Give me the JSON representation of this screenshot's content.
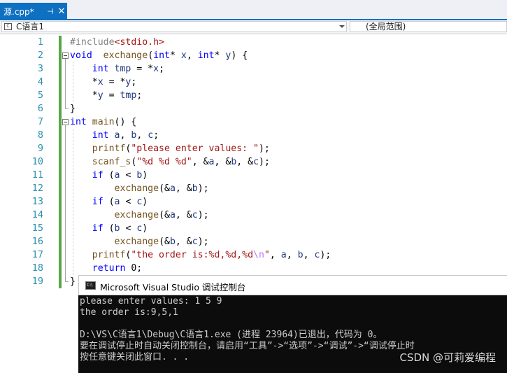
{
  "tab": {
    "title": "源.cpp*",
    "pin": "⊣",
    "close": "✕"
  },
  "nav": {
    "project": "C语言1",
    "scope": "(全局范围)"
  },
  "code_lines": [
    {
      "n": "1"
    },
    {
      "n": "2"
    },
    {
      "n": "3"
    },
    {
      "n": "4"
    },
    {
      "n": "5"
    },
    {
      "n": "6"
    },
    {
      "n": "7"
    },
    {
      "n": "8"
    },
    {
      "n": "9"
    },
    {
      "n": "10"
    },
    {
      "n": "11"
    },
    {
      "n": "12"
    },
    {
      "n": "13"
    },
    {
      "n": "14"
    },
    {
      "n": "15"
    },
    {
      "n": "16"
    },
    {
      "n": "17"
    },
    {
      "n": "18"
    },
    {
      "n": "19"
    }
  ],
  "code": {
    "l1": [
      [
        "pp",
        "#include"
      ],
      [
        "inc",
        "<stdio.h>"
      ]
    ],
    "l2": [
      [
        "kw",
        "void"
      ],
      [
        "",
        "  "
      ],
      [
        "fn",
        "exchange"
      ],
      [
        "",
        "("
      ],
      [
        "kw",
        "int"
      ],
      [
        "",
        "* "
      ],
      [
        "var",
        "x"
      ],
      [
        "",
        ", "
      ],
      [
        "kw",
        "int"
      ],
      [
        "",
        "* "
      ],
      [
        "var",
        "y"
      ],
      [
        "",
        ") {"
      ]
    ],
    "l3": [
      [
        "",
        "    "
      ],
      [
        "kw",
        "int"
      ],
      [
        "",
        ""
      ],
      [
        "var",
        " tmp"
      ],
      [
        "",
        ""
      ],
      [
        "",
        " = *"
      ],
      [
        "var",
        "x"
      ],
      [
        "",
        ";"
      ]
    ],
    "l4": [
      [
        "",
        "    *"
      ],
      [
        "var",
        "x"
      ],
      [
        "",
        ""
      ],
      [
        "",
        " = *"
      ],
      [
        "var",
        "y"
      ],
      [
        "",
        ";"
      ]
    ],
    "l5": [
      [
        "",
        "    *"
      ],
      [
        "var",
        "y"
      ],
      [
        "",
        ""
      ],
      [
        "",
        " = "
      ],
      [
        "var",
        "tmp"
      ],
      [
        "",
        ";"
      ]
    ],
    "l6": [
      [
        "",
        "}"
      ]
    ],
    "l7": [
      [
        "kw",
        "int"
      ],
      [
        "",
        " "
      ],
      [
        "fn",
        "main"
      ],
      [
        "",
        "() {"
      ]
    ],
    "l8": [
      [
        "",
        "    "
      ],
      [
        "kw",
        "int"
      ],
      [
        "",
        " "
      ],
      [
        "var",
        "a"
      ],
      [
        "",
        ", "
      ],
      [
        "var",
        "b"
      ],
      [
        "",
        ", "
      ],
      [
        "var",
        "c"
      ],
      [
        "",
        ";"
      ]
    ],
    "l9": [
      [
        "",
        "    "
      ],
      [
        "fn",
        "printf"
      ],
      [
        "",
        "("
      ],
      [
        "str",
        "\"please enter values: \""
      ],
      [
        "",
        ");"
      ]
    ],
    "l10": [
      [
        "",
        "    "
      ],
      [
        "fn",
        "scanf_s"
      ],
      [
        "",
        "("
      ],
      [
        "str",
        "\"%d %d %d\""
      ],
      [
        "",
        ", &"
      ],
      [
        "var",
        "a"
      ],
      [
        "",
        ", &"
      ],
      [
        "var",
        "b"
      ],
      [
        "",
        ", &"
      ],
      [
        "var",
        "c"
      ],
      [
        "",
        ");"
      ]
    ],
    "l11": [
      [
        "",
        "    "
      ],
      [
        "kw",
        "if"
      ],
      [
        "",
        " ("
      ],
      [
        "var",
        "a"
      ],
      [
        "",
        " < "
      ],
      [
        "var",
        "b"
      ],
      [
        "",
        ")"
      ]
    ],
    "l12": [
      [
        "",
        "        "
      ],
      [
        "fn",
        "exchange"
      ],
      [
        "",
        "(&"
      ],
      [
        "var",
        "a"
      ],
      [
        "",
        ", &"
      ],
      [
        "var",
        "b"
      ],
      [
        "",
        ");"
      ]
    ],
    "l13": [
      [
        "",
        "    "
      ],
      [
        "kw",
        "if"
      ],
      [
        "",
        " ("
      ],
      [
        "var",
        "a"
      ],
      [
        "",
        " < "
      ],
      [
        "var",
        "c"
      ],
      [
        "",
        ")"
      ]
    ],
    "l14": [
      [
        "",
        "        "
      ],
      [
        "fn",
        "exchange"
      ],
      [
        "",
        "(&"
      ],
      [
        "var",
        "a"
      ],
      [
        "",
        ", &"
      ],
      [
        "var",
        "c"
      ],
      [
        "",
        ");"
      ]
    ],
    "l15": [
      [
        "",
        "    "
      ],
      [
        "kw",
        "if"
      ],
      [
        "",
        " ("
      ],
      [
        "var",
        "b"
      ],
      [
        "",
        " < "
      ],
      [
        "var",
        "c"
      ],
      [
        "",
        ")"
      ]
    ],
    "l16": [
      [
        "",
        "        "
      ],
      [
        "fn",
        "exchange"
      ],
      [
        "",
        "(&"
      ],
      [
        "var",
        "b"
      ],
      [
        "",
        ", &"
      ],
      [
        "var",
        "c"
      ],
      [
        "",
        ");"
      ]
    ],
    "l17": [
      [
        "",
        "    "
      ],
      [
        "fn",
        "printf"
      ],
      [
        "",
        "("
      ],
      [
        "str",
        "\"the order is:%d,%d,%d"
      ],
      [
        "esc",
        "\\n"
      ],
      [
        "str",
        "\""
      ],
      [
        "",
        ", "
      ],
      [
        "var",
        "a"
      ],
      [
        "",
        ", "
      ],
      [
        "var",
        "b"
      ],
      [
        "",
        ", "
      ],
      [
        "var",
        "c"
      ],
      [
        "",
        ");"
      ]
    ],
    "l18": [
      [
        "",
        "    "
      ],
      [
        "kw",
        "return"
      ],
      [
        "",
        " 0;"
      ]
    ],
    "l19": [
      [
        "",
        "}"
      ]
    ]
  },
  "console": {
    "title": "Microsoft Visual Studio 调试控制台",
    "icon_text": "C:\\",
    "lines": [
      "please enter values: 1 5 9",
      "the order is:9,5,1",
      "",
      "D:\\VS\\C语言1\\Debug\\C语言1.exe (进程 23964)已退出，代码为 0。",
      "要在调试停止时自动关闭控制台，请启用“工具”->“选项”->“调试”->“调试停止时",
      "按任意键关闭此窗口. . ."
    ]
  },
  "watermark": "CSDN @可莉爱编程",
  "colors": {
    "accent": "#0e70c0",
    "keyword": "#0000ff",
    "string": "#a31515",
    "linenum": "#2b91af",
    "changebar": "#57a64a"
  }
}
